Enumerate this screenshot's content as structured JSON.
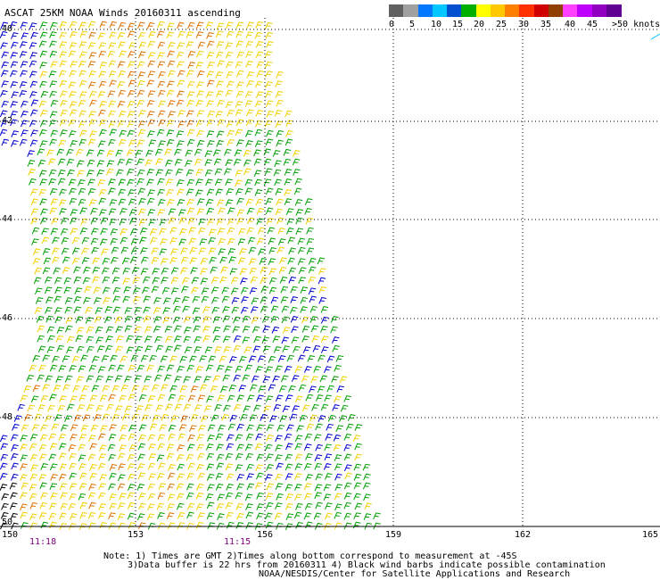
{
  "title": "ASCAT 25KM NOAA Winds 20160311 ascending",
  "legend": {
    "labels": [
      "0",
      "5",
      "10",
      "15",
      "20",
      "25",
      "30",
      "35",
      "40",
      "45",
      ">50 knots"
    ],
    "colors": [
      "#606060",
      "#a0a0a0",
      "#0078ff",
      "#00c8ff",
      "#0050d0",
      "#00b000",
      "#ffff00",
      "#ffc800",
      "#ff8000",
      "#ff3000",
      "#d00000",
      "#904000",
      "#ff40ff",
      "#c000ff",
      "#9000c0",
      "#600090"
    ]
  },
  "lat_labels": [
    "40",
    "42",
    "44",
    "46",
    "48",
    "50"
  ],
  "lon_labels": [
    "150",
    "153",
    "156",
    "159",
    "162",
    "165"
  ],
  "time_labels": [
    "11:18",
    "11:15"
  ],
  "notes": [
    "Note: 1) Times are GMT 2)Times along bottom correspond to measurement at -45S",
    "3)Data buffer is 22 hrs from 20160311 4) Black wind barbs indicate possible contamination",
    "NOAA/NESDIS/Center for Satellite Applications and Research"
  ],
  "wind_colors": {
    "strong": "#e07000",
    "moderate": "#f0d000",
    "fresh": "#00a000",
    "light": "#0000d0",
    "contaminated": "#000000"
  }
}
